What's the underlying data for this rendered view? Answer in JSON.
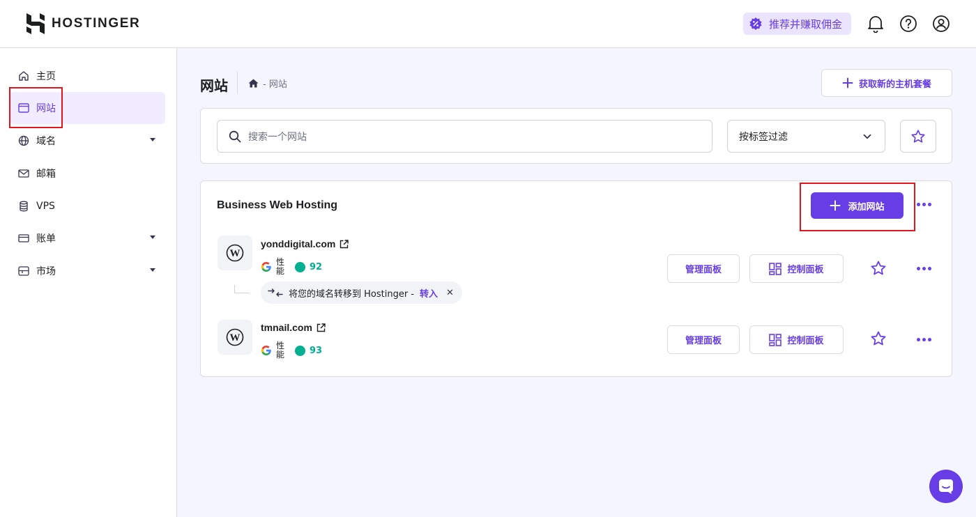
{
  "brand": {
    "name": "HOSTINGER",
    "accent": "#673de6",
    "highlight": "#e0151d",
    "success": "#00b090"
  },
  "header": {
    "referral_label": "推荐并赚取佣金",
    "icons": [
      "referral-icon",
      "bell-icon",
      "help-icon",
      "account-icon"
    ]
  },
  "sidebar": {
    "items": [
      {
        "label": "主页",
        "icon": "home-icon"
      },
      {
        "label": "网站",
        "icon": "browser-icon",
        "active": true
      },
      {
        "label": "域名",
        "icon": "globe-icon",
        "expandable": true
      },
      {
        "label": "邮箱",
        "icon": "mail-icon"
      },
      {
        "label": "VPS",
        "icon": "database-icon"
      },
      {
        "label": "账单",
        "icon": "card-icon",
        "expandable": true
      },
      {
        "label": "市场",
        "icon": "store-icon",
        "expandable": true
      }
    ]
  },
  "page": {
    "title": "网站",
    "breadcrumb": "- 网站",
    "get_plan_label": "获取新的主机套餐"
  },
  "search": {
    "placeholder": "搜索一个网站",
    "filter_label": "按标签过滤"
  },
  "hosting": {
    "title": "Business Web Hosting",
    "add_label": "添加网站",
    "sites": [
      {
        "domain": "yonddigital.com",
        "perf_label": "性能",
        "score": "92",
        "manage_label": "管理面板",
        "control_label": "控制面板",
        "transfer_text": "将您的域名转移到 Hostinger -",
        "transfer_link": "转入"
      },
      {
        "domain": "tmnail.com",
        "perf_label": "性能",
        "score": "93",
        "manage_label": "管理面板",
        "control_label": "控制面板"
      }
    ]
  }
}
